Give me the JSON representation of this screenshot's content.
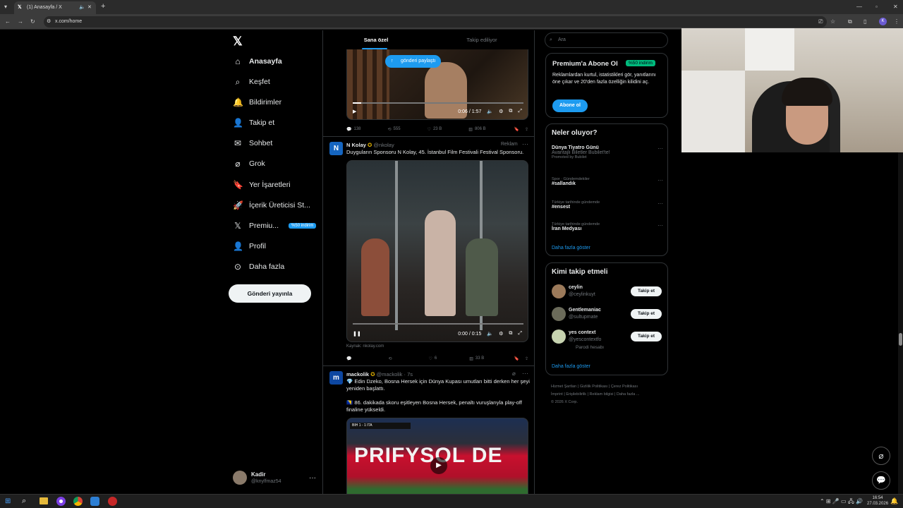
{
  "browser": {
    "tab_title": "(1) Anasayfa / X",
    "url": "x.com/home"
  },
  "nav": {
    "items": [
      {
        "label": "Anasayfa",
        "icon": "home-icon",
        "glyph": "⌂"
      },
      {
        "label": "Keşfet",
        "icon": "search-icon",
        "glyph": "⌕"
      },
      {
        "label": "Bildirimler",
        "icon": "bell-icon",
        "glyph": "🔔"
      },
      {
        "label": "Takip et",
        "icon": "add-user-icon",
        "glyph": "👤"
      },
      {
        "label": "Sohbet",
        "icon": "mail-icon",
        "glyph": "✉"
      },
      {
        "label": "Grok",
        "icon": "grok-icon",
        "glyph": "⌀"
      },
      {
        "label": "Yer İşaretleri",
        "icon": "bookmark-icon",
        "glyph": "🔖"
      },
      {
        "label": "İçerik Üreticisi St...",
        "icon": "rocket-icon",
        "glyph": "🚀"
      },
      {
        "label": "Premiu...",
        "icon": "x-premium-icon",
        "glyph": "𝕏",
        "badge": "%50 indirim"
      },
      {
        "label": "Profil",
        "icon": "profile-icon",
        "glyph": "👤"
      },
      {
        "label": "Daha fazla",
        "icon": "more-circle-icon",
        "glyph": "⊙"
      }
    ],
    "post_button": "Gönderi yayınla",
    "account": {
      "name": "Kadir",
      "handle": "@knylfmaz54"
    }
  },
  "feed": {
    "tabs": [
      "Sana özel",
      "Takip ediliyor"
    ],
    "share_pill": "gönderi paylaştı",
    "video1": {
      "time": "0:06 / 1:57",
      "progress": 0.05
    },
    "tweet1_actions": {
      "replies": "138",
      "retweets": "555",
      "likes": "23 B",
      "views": "806 B"
    },
    "ad": {
      "name": "N Kolay",
      "handle": "@nkolay",
      "tag": "Reklam",
      "text": "Duyguların Sponsoru N Kolay, 45. İstanbul Film Festivali Festival Sponsoru.",
      "video_time": "0:00 / 0:15",
      "source": "Kaynak: nkolay.com",
      "likes": "6",
      "views": "33 B"
    },
    "tweet2": {
      "name": "mackolik",
      "handle": "@mackolik",
      "time": "7s",
      "line1": "💎 Edin Dzeko, Bosna Hersek için Dünya Kupası umutları bitti derken her şeyi yeniden başlattı.",
      "line2": "🇧🇦 86. dakikada skoru eşitleyen Bosna Hersek, penaltı vuruşlarıyla play-off finaline yükseldi.",
      "image_text": "PRIFYSOL DE"
    }
  },
  "right": {
    "search_placeholder": "Ara",
    "premium": {
      "title": "Premium'a Abone Ol",
      "badge": "%50 indirim",
      "desc": "Reklamlardan kurtul, istatistikleri gör, yanıtlarını öne çıkar ve 20'den fazla özelliğin kilidini aç.",
      "button": "Abone ol"
    },
    "trends": {
      "title": "Neler oluyor?",
      "items": [
        {
          "top": "",
          "name": "Dünya Tiyatro Günü",
          "sub": "Avantajlı Biletler Bubilet'te!",
          "promo": "Promoted by Bubilet"
        },
        {
          "top": "Spor · Gündemdekiler",
          "name": "#sallandık",
          "sub": "",
          "promo": ""
        },
        {
          "top": "Türkiye tarihinde gündemde",
          "name": "#ensest",
          "sub": "",
          "promo": ""
        },
        {
          "top": "Türkiye tarihinde gündemde",
          "name": "İran Medyası",
          "sub": "",
          "promo": ""
        }
      ],
      "more": "Daha fazla göster"
    },
    "who": {
      "title": "Kimi takip etmeli",
      "items": [
        {
          "name": "ceylin",
          "handle": "@ceylinkuyt",
          "extra": ""
        },
        {
          "name": "Gentlemaniac",
          "handle": "@sultupmate",
          "extra": ""
        },
        {
          "name": "yes context",
          "handle": "@yescontextfo",
          "extra": "Parodi hesabı"
        }
      ],
      "follow": "Takip et",
      "more": "Daha fazla göster"
    },
    "footer": {
      "line1": [
        "Hizmet Şartları",
        "Gizlilik Politikası",
        "Çerez Politikası"
      ],
      "line2": [
        "İmprint",
        "Erişilebilirlik",
        "Reklam bilgisi",
        "Daha fazla ..."
      ],
      "copyright": "© 2026 X Corp."
    }
  },
  "taskbar": {
    "time": "16:54",
    "date": "27.03.2026"
  },
  "colors": {
    "accent": "#1d9bf0",
    "bg": "#000000",
    "border": "#2f3336",
    "premium_badge": "#00ba7c"
  }
}
